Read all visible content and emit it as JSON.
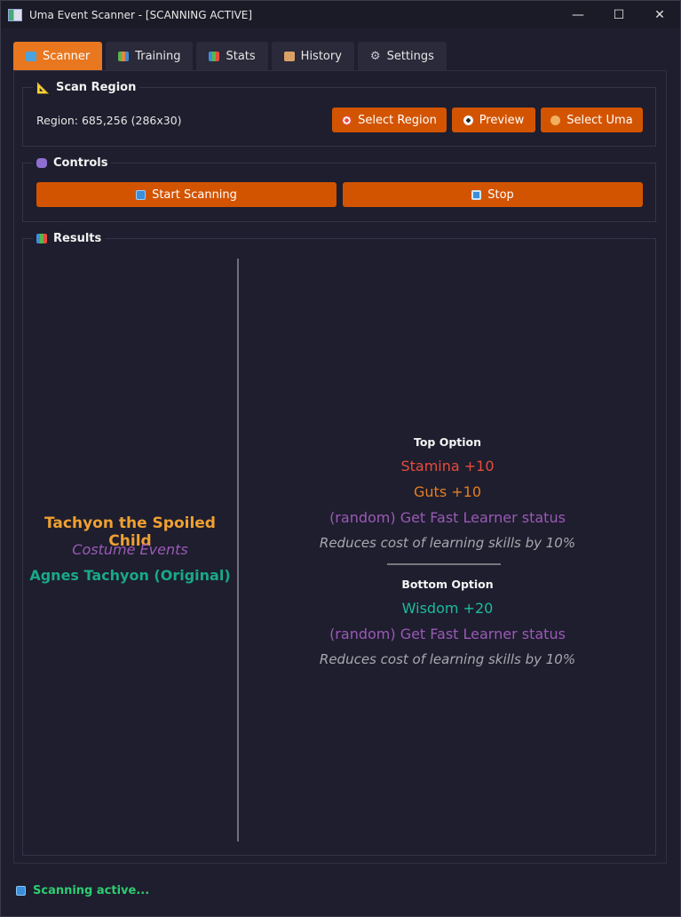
{
  "window": {
    "title": "Uma Event Scanner - [SCANNING ACTIVE]",
    "minimize_glyph": "—",
    "maximize_glyph": "☐",
    "close_glyph": "✕"
  },
  "tabs": [
    {
      "label": "Scanner",
      "icon": "monitor-icon",
      "color": "#4aa3df"
    },
    {
      "label": "Training",
      "icon": "books-icon",
      "color": "#5ab54a"
    },
    {
      "label": "Stats",
      "icon": "bar-chart-icon",
      "color": "#c9a23a"
    },
    {
      "label": "History",
      "icon": "scroll-icon",
      "color": "#d9a066"
    },
    {
      "label": "Settings",
      "icon": "gear-icon",
      "color": "#b0b0b8"
    }
  ],
  "scan_region": {
    "title": "Scan Region",
    "region_text": "Region: 685,256 (286x30)",
    "buttons": {
      "select_region": "Select Region",
      "preview": "Preview",
      "select_uma": "Select Uma"
    }
  },
  "controls": {
    "title": "Controls",
    "start": "Start Scanning",
    "stop": "Stop"
  },
  "results": {
    "title": "Results",
    "event_title": "Tachyon the Spoiled Child",
    "event_category": "Costume Events",
    "event_character": "Agnes Tachyon (Original)",
    "top_option": {
      "heading": "Top Option",
      "effects": [
        {
          "text": "Stamina +10",
          "color": "#e74c3c"
        },
        {
          "text": "Guts +10",
          "color": "#e67e22"
        },
        {
          "text": "(random) Get Fast Learner status",
          "color": "#9b59b6"
        }
      ],
      "note": "Reduces cost of learning skills by 10%"
    },
    "bottom_option": {
      "heading": "Bottom Option",
      "effects": [
        {
          "text": "Wisdom +20",
          "color": "#1abc9c"
        },
        {
          "text": "(random) Get Fast Learner status",
          "color": "#9b59b6"
        }
      ],
      "note": "Reduces cost of learning skills by 10%"
    }
  },
  "status": {
    "text": "Scanning active..."
  },
  "colors": {
    "accent_orange": "#e8771f",
    "button_orange": "#d35400",
    "status_green": "#2ecc71",
    "background": "#1e1e2e"
  }
}
